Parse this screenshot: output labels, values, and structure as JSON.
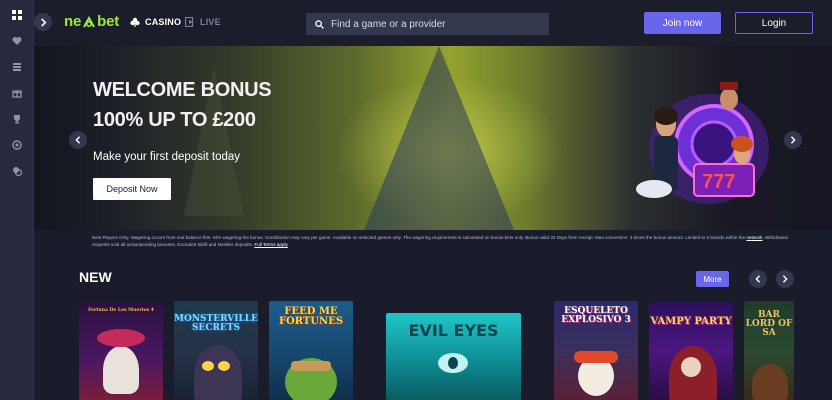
{
  "brand": {
    "logo_left": "ne",
    "logo_right": "bet",
    "accent": "#9eea3a"
  },
  "rail": {
    "icons": [
      "grid-icon",
      "heart-icon",
      "list-icon",
      "gift-icon",
      "trophy-icon",
      "chip-icon",
      "coins-icon"
    ]
  },
  "nav": {
    "casino": "CASINO",
    "live": "LIVE"
  },
  "search": {
    "placeholder": "Find a game or a provider"
  },
  "auth": {
    "join": "Join now",
    "login": "Login"
  },
  "hero": {
    "line1": "WELCOME BONUS",
    "line2": "100% UP TO £200",
    "subtitle": "Make your first deposit today",
    "cta": "Deposit Now",
    "terms": "New Players Only. Wagering occurs from real balance first. 50X wagering the bonus. Contribution may vary per game. Available on selected games only. The wagering requirement is calculated on bonus bets only. Bonus valid 30 Days from receipt. Max conversion: 3 times the bonus amount. Limited to 5 brands within the",
    "terms_link1": "network",
    "terms_tail": ". Withdrawal requests void all active/pending bonuses. Excluded Skrill and Neteller deposits.",
    "terms_link2": "Full Terms apply"
  },
  "section": {
    "title": "NEW",
    "more": "More"
  },
  "games": [
    {
      "title": "Fortuna De Los Muertos 4",
      "bg": "#3a1450"
    },
    {
      "title": "MONSTERVILLE SECRETS",
      "bg": "#24394a"
    },
    {
      "title": "FEED ME FORTUNES",
      "bg": "#1a4f7a"
    },
    {
      "title": "EVIL EYES",
      "bg": "#0f6e76"
    },
    {
      "title": "ESQUELETO EXPLOSIVO 3",
      "bg": "#2b2f5a"
    },
    {
      "title": "VAMPY PARTY",
      "bg": "#3a1068"
    },
    {
      "title": "BAR LORD OF SA",
      "bg": "#1d3a2a"
    }
  ]
}
